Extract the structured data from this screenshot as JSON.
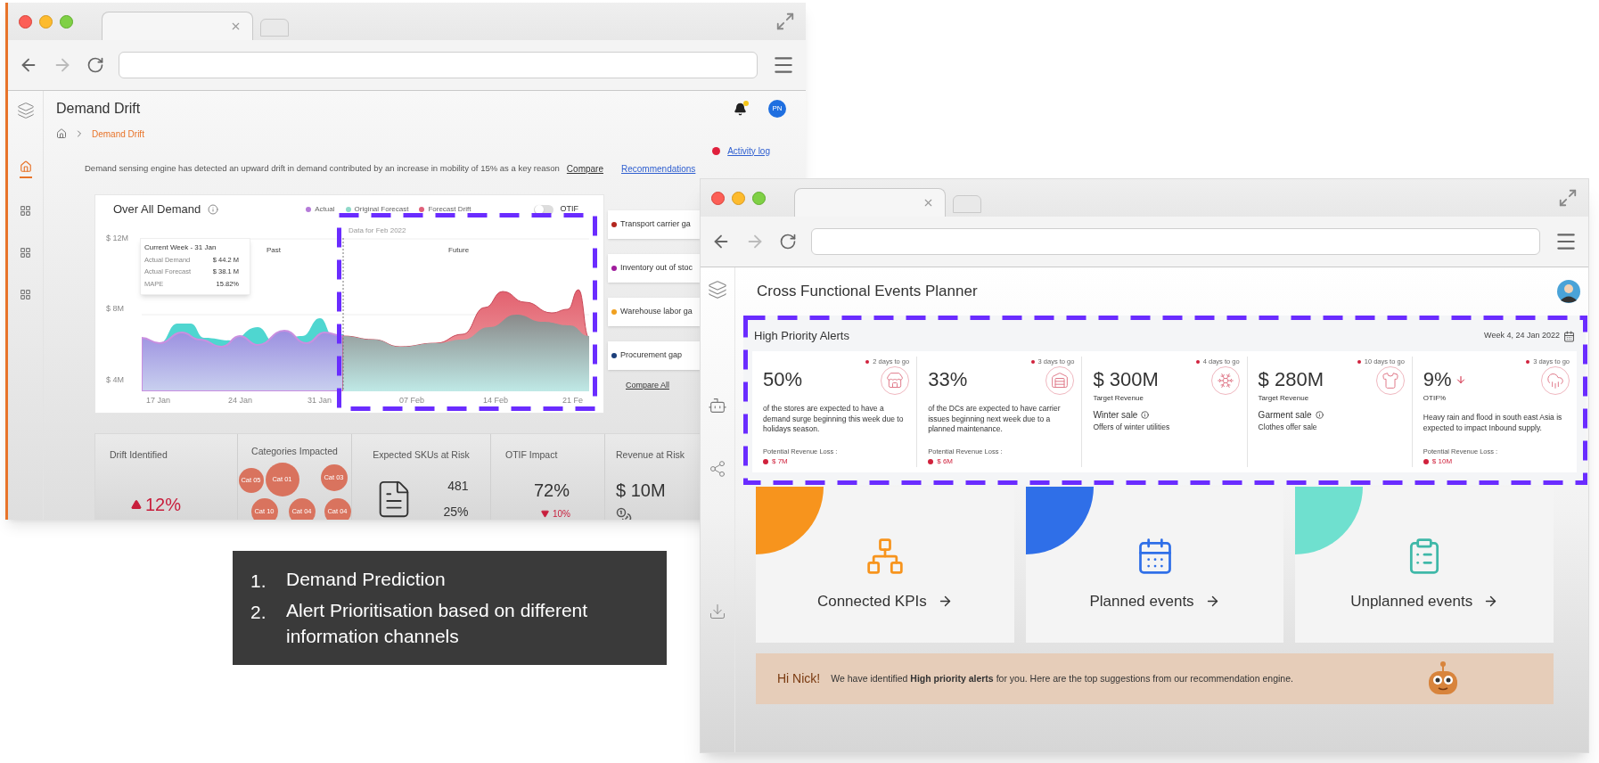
{
  "demand_window": {
    "nav": [
      {
        "kind": "home",
        "selected": true
      },
      {
        "kind": "grid",
        "selected": false
      },
      {
        "kind": "grid",
        "selected": false
      },
      {
        "kind": "grid",
        "selected": false
      }
    ],
    "title": "Demand Drift",
    "breadcrumb": "Demand Drift",
    "notifications": {
      "unread": true
    },
    "avatar": "PN",
    "activity_log": "Activity log",
    "message": "Demand sensing engine has detected an upward drift in demand contributed by an increase in mobility of 15% as a key reason",
    "links": [
      "Compare",
      "Recommendations"
    ],
    "chart": {
      "title": "Over All Demand",
      "legend": [
        {
          "label": "Actual",
          "color": "#b57bd9"
        },
        {
          "label": "Original Forecast",
          "color": "#8fd9c9"
        },
        {
          "label": "Forecast Drift",
          "color": "#e0607a"
        }
      ],
      "toggle": {
        "label": "OTIF",
        "on": false
      },
      "tooltip": {
        "title": "Current Week - 31 Jan",
        "rows": [
          {
            "label": "Actual Demand",
            "value": "$ 44.2 M"
          },
          {
            "label": "Actual Forecast",
            "value": "$ 38.1 M"
          },
          {
            "label": "MAPE",
            "value": "15.82%"
          }
        ]
      },
      "periods": [
        "Past",
        "Future"
      ],
      "range_note": "Data for Feb 2022",
      "y_ticks": [
        "$ 12M",
        "$ 8M",
        "$ 4M"
      ],
      "x_ticks": [
        "17 Jan",
        "24 Jan",
        "31 Jan",
        "07 Feb",
        "14 Feb",
        "21 Fe"
      ]
    },
    "gaps": [
      {
        "label": "Transport carrier ga",
        "color": "#b3261e"
      },
      {
        "label": "Inventory out of stoc",
        "color": "#a01c9c"
      },
      {
        "label": "Warehouse labor ga",
        "color": "#f0a020"
      },
      {
        "label": "Procurement gap",
        "color": "#1c3f7a"
      }
    ],
    "compare_all": "Compare All",
    "metrics": [
      {
        "kind": "trend",
        "label": "Drift Identified",
        "value": "12%",
        "increase": true
      },
      {
        "kind": "bubbles",
        "label": "Categories Impacted",
        "bubbles": [
          "Cat 05",
          "Cat 01",
          "Cat 03",
          "Cat 10",
          "Cat 04",
          "Cat 04"
        ]
      },
      {
        "kind": "document",
        "label": "Expected SKUs at Risk",
        "values": [
          "481",
          "25%"
        ]
      },
      {
        "kind": "change",
        "label": "OTIF Impact",
        "value": "72%",
        "change": "10%",
        "increase": false
      },
      {
        "kind": "money",
        "label": "Revenue at Risk",
        "value": "$ 10M"
      }
    ]
  },
  "notes": [
    {
      "number": "1.",
      "text": "Demand Prediction"
    },
    {
      "number": "2.",
      "text": "Alert Prioritisation based on different information channels"
    }
  ],
  "planner_window": {
    "title": "Cross Functional Events Planner",
    "alerts": {
      "title": "High Priority Alerts",
      "date": "Week 4, 24 Jan 2022",
      "items": [
        {
          "kind": "store",
          "days": "2 days to go",
          "value": "50%",
          "description": "of the stores are expected to have a demand surge beginning this week due to holidays season.",
          "loss_label": "Potential Revenue Loss :",
          "loss": "$ 7M"
        },
        {
          "kind": "warehouse",
          "days": "3 days to go",
          "value": "33%",
          "description": "of the DCs are expected to have carrier issues beginning next week due to a planned maintenance.",
          "loss_label": "Potential Revenue Loss :",
          "loss": "$ 6M"
        },
        {
          "kind": "snowflake",
          "days": "4 days to go",
          "value": "$ 300M",
          "caption": "Target Revenue",
          "event": "Winter sale",
          "description": "Offers of winter utilities"
        },
        {
          "kind": "shirt",
          "days": "10 days to go",
          "value": "$ 280M",
          "caption": "Target Revenue",
          "event": "Garment sale",
          "description": "Clothes offer sale"
        },
        {
          "kind": "rain",
          "days": "3 days to go",
          "value": "9%",
          "falling": true,
          "caption": "OTIF%",
          "description": "Heavy rain and flood in south east Asia is expected to impact Inbound supply.",
          "loss_label": "Potential Revenue Loss :",
          "loss": "$ 10M"
        }
      ]
    },
    "shortcuts": [
      {
        "kind": "hierarchy",
        "label": "Connected KPIs",
        "color": "#f7941d"
      },
      {
        "kind": "calendar",
        "label": "Planned events",
        "color": "#2f6fe8"
      },
      {
        "kind": "clipboard",
        "label": "Unplanned events",
        "color": "#6fe0cf"
      }
    ],
    "banner": {
      "greeting": "Hi Nick!",
      "message": "We have identified **High priority alerts** for you. Here are the top suggestions from our recommendation engine."
    }
  }
}
